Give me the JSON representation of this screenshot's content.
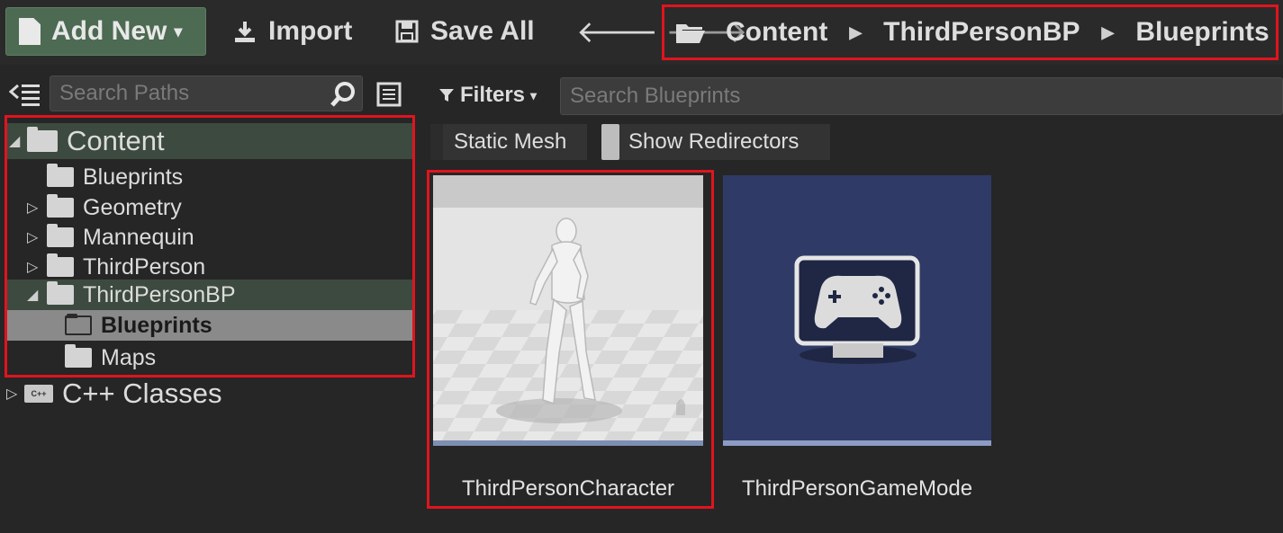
{
  "toolbar": {
    "add_new_label": "Add New",
    "import_label": "Import",
    "save_all_label": "Save All"
  },
  "breadcrumb": {
    "items": [
      "Content",
      "ThirdPersonBP",
      "Blueprints"
    ]
  },
  "sources": {
    "search_placeholder": "Search Paths",
    "tree": [
      {
        "label": "Content",
        "depth": 0,
        "expanded": true
      },
      {
        "label": "Blueprints",
        "depth": 1
      },
      {
        "label": "Geometry",
        "depth": 1,
        "expandable": true
      },
      {
        "label": "Mannequin",
        "depth": 1,
        "expandable": true
      },
      {
        "label": "ThirdPerson",
        "depth": 1,
        "expandable": true
      },
      {
        "label": "ThirdPersonBP",
        "depth": 1,
        "expanded": true
      },
      {
        "label": "Blueprints",
        "depth": 2,
        "selected": true
      },
      {
        "label": "Maps",
        "depth": 2
      }
    ],
    "cpp_label": "C++ Classes",
    "cpp_badge": "C++"
  },
  "assets_panel": {
    "filters_label": "Filters",
    "search_placeholder": "Search Blueprints",
    "filter_chips": [
      "Static Mesh",
      "Show Redirectors"
    ],
    "assets": [
      {
        "name": "ThirdPersonCharacter",
        "icon": "mannequin-thumbnail"
      },
      {
        "name": "ThirdPersonGameMode",
        "icon": "gamepad-monitor-icon"
      }
    ]
  },
  "colors": {
    "highlight_border": "#e0141e",
    "add_new_bg": "#4d6a52",
    "game_mode_bg": "#2f3b66"
  }
}
